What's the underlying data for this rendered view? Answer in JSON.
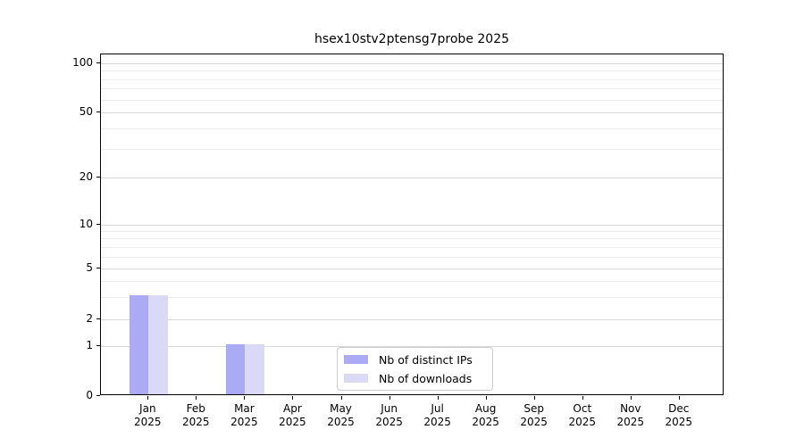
{
  "chart_data": {
    "type": "bar",
    "title": "hsex10stv2ptensg7probe 2025",
    "categories": [
      "Jan",
      "Feb",
      "Mar",
      "Apr",
      "May",
      "Jun",
      "Jul",
      "Aug",
      "Sep",
      "Oct",
      "Nov",
      "Dec"
    ],
    "category_year": "2025",
    "series": [
      {
        "name": "Nb of distinct IPs",
        "color": "#aaaaf5",
        "values": [
          3,
          0,
          1,
          0,
          0,
          0,
          0,
          0,
          0,
          0,
          0,
          0
        ]
      },
      {
        "name": "Nb of downloads",
        "color": "#dadaf8",
        "values": [
          3,
          0,
          1,
          0,
          0,
          0,
          0,
          0,
          0,
          0,
          0,
          0
        ]
      }
    ],
    "y_axis": {
      "scale": "symlog",
      "ylim": [
        0,
        100
      ],
      "major_ticks": [
        0,
        1,
        2,
        5,
        10,
        20,
        50,
        100
      ],
      "minor_gridlines": [
        3,
        4,
        6,
        7,
        8,
        9,
        30,
        40,
        60,
        70,
        80,
        90
      ]
    },
    "legend_position": "lower center",
    "grid": "on",
    "colors": {
      "grid_major": "#d6d6d6",
      "grid_minor": "#ededed",
      "axis": "#000000",
      "legend_border": "#cccccc",
      "background": "#ffffff"
    }
  }
}
